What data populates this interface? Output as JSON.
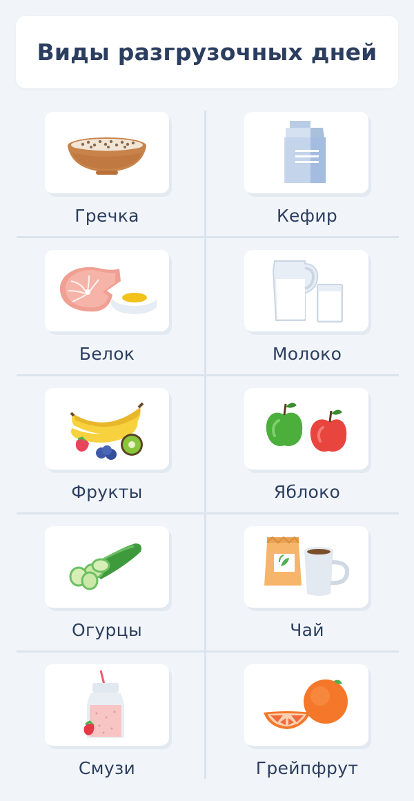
{
  "title": "Виды разгрузочных дней",
  "items": [
    {
      "label": "Гречка",
      "icon": "buckwheat-bowl-icon"
    },
    {
      "label": "Кефир",
      "icon": "kefir-carton-icon"
    },
    {
      "label": "Белок",
      "icon": "salmon-egg-icon"
    },
    {
      "label": "Молоко",
      "icon": "milk-jug-icon"
    },
    {
      "label": "Фрукты",
      "icon": "fruits-icon"
    },
    {
      "label": "Яблоко",
      "icon": "apples-icon"
    },
    {
      "label": "Огурцы",
      "icon": "cucumber-icon"
    },
    {
      "label": "Чай",
      "icon": "tea-cup-icon"
    },
    {
      "label": "Смузи",
      "icon": "smoothie-icon"
    },
    {
      "label": "Грейпфрут",
      "icon": "grapefruit-icon"
    }
  ],
  "colors": {
    "background": "#f1f5f9",
    "text": "#2c3e5f",
    "divider": "#dbe3ec",
    "card": "#ffffff"
  }
}
